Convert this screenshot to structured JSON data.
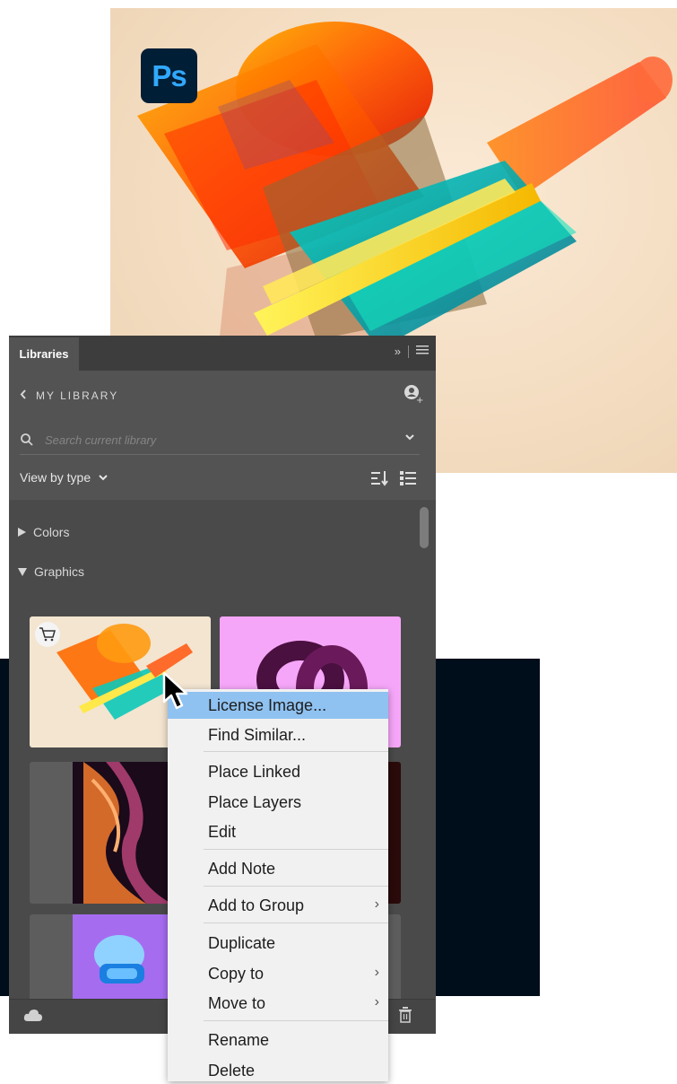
{
  "panel": {
    "tab_label": "Libraries",
    "library_title": "MY LIBRARY",
    "search_placeholder": "Search current library",
    "view_by": "View by type",
    "sections": [
      {
        "label": "Colors",
        "expanded": false
      },
      {
        "label": "Graphics",
        "expanded": true
      }
    ]
  },
  "context_menu": {
    "items": [
      {
        "label": "License Image...",
        "highlighted": true,
        "submenu": false
      },
      {
        "label": "Find Similar...",
        "highlighted": false,
        "submenu": false
      },
      {
        "label": "Place Linked",
        "highlighted": false,
        "submenu": false
      },
      {
        "label": "Place Layers",
        "highlighted": false,
        "submenu": false
      },
      {
        "label": "Edit",
        "highlighted": false,
        "submenu": false
      },
      {
        "label": "Add Note",
        "highlighted": false,
        "submenu": false
      },
      {
        "label": "Add to Group",
        "highlighted": false,
        "submenu": true
      },
      {
        "label": "Duplicate",
        "highlighted": false,
        "submenu": false
      },
      {
        "label": "Copy to",
        "highlighted": false,
        "submenu": true
      },
      {
        "label": "Move to",
        "highlighted": false,
        "submenu": true
      },
      {
        "label": "Rename",
        "highlighted": false,
        "submenu": false
      },
      {
        "label": "Delete",
        "highlighted": false,
        "submenu": false
      }
    ]
  },
  "app_badge": "Ps",
  "colors": {
    "highlight": "#8fc2f1",
    "panel": "#535353",
    "ps_badge_bg": "#001e36",
    "ps_badge_text": "#31a8ff"
  }
}
